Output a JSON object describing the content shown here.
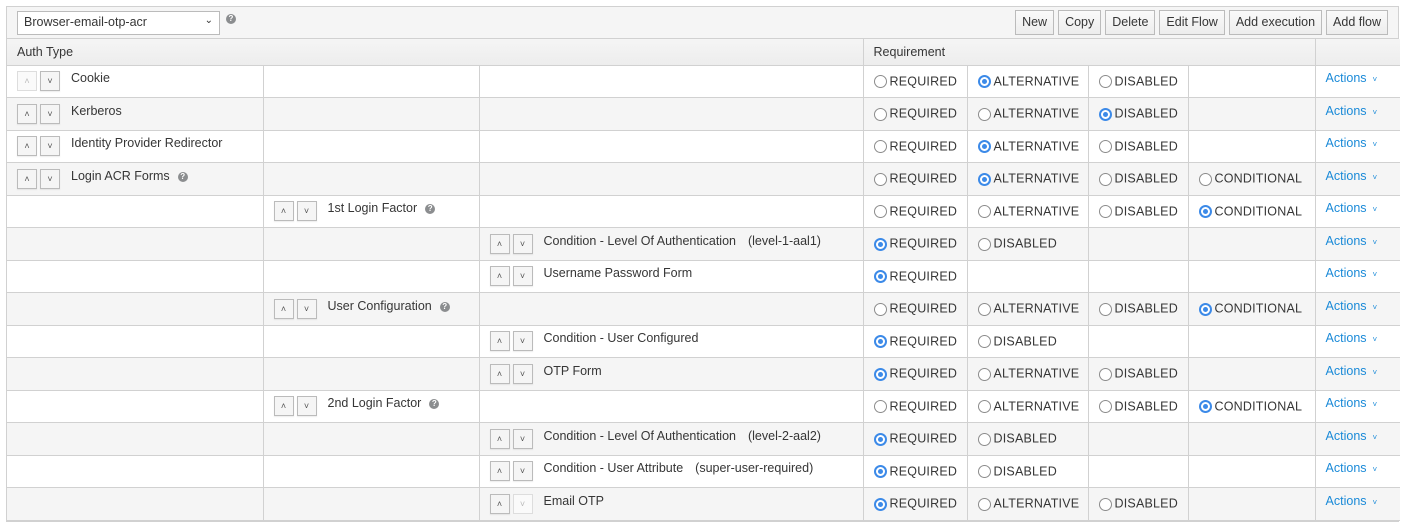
{
  "toolbar": {
    "flow_selected": "Browser-email-otp-acr",
    "buttons": {
      "new": "New",
      "copy": "Copy",
      "delete": "Delete",
      "edit_flow": "Edit Flow",
      "add_execution": "Add execution",
      "add_flow": "Add flow"
    }
  },
  "table": {
    "headers": {
      "auth_type": "Auth Type",
      "requirement": "Requirement"
    },
    "actions_label": "Actions",
    "rows": [
      {
        "level": 0,
        "name": "Cookie",
        "alias": "",
        "help": false,
        "up_disabled": true,
        "down_disabled": false,
        "options": [
          "REQUIRED",
          "ALTERNATIVE",
          "DISABLED"
        ],
        "selected": "ALTERNATIVE"
      },
      {
        "level": 0,
        "name": "Kerberos",
        "alias": "",
        "help": false,
        "up_disabled": false,
        "down_disabled": false,
        "options": [
          "REQUIRED",
          "ALTERNATIVE",
          "DISABLED"
        ],
        "selected": "DISABLED"
      },
      {
        "level": 0,
        "name": "Identity Provider Redirector",
        "alias": "",
        "help": false,
        "up_disabled": false,
        "down_disabled": false,
        "options": [
          "REQUIRED",
          "ALTERNATIVE",
          "DISABLED"
        ],
        "selected": "ALTERNATIVE"
      },
      {
        "level": 0,
        "name": "Login ACR Forms",
        "alias": "",
        "help": true,
        "up_disabled": false,
        "down_disabled": false,
        "options": [
          "REQUIRED",
          "ALTERNATIVE",
          "DISABLED",
          "CONDITIONAL"
        ],
        "selected": "ALTERNATIVE"
      },
      {
        "level": 1,
        "name": "1st Login Factor",
        "alias": "",
        "help": true,
        "up_disabled": false,
        "down_disabled": false,
        "options": [
          "REQUIRED",
          "ALTERNATIVE",
          "DISABLED",
          "CONDITIONAL"
        ],
        "selected": "CONDITIONAL"
      },
      {
        "level": 2,
        "name": "Condition - Level Of Authentication",
        "alias": "(level-1-aal1)",
        "help": false,
        "up_disabled": false,
        "down_disabled": false,
        "options": [
          "REQUIRED",
          "DISABLED"
        ],
        "selected": "REQUIRED"
      },
      {
        "level": 2,
        "name": "Username Password Form",
        "alias": "",
        "help": false,
        "up_disabled": false,
        "down_disabled": false,
        "options": [
          "REQUIRED"
        ],
        "selected": "REQUIRED"
      },
      {
        "level": 1,
        "name": "User Configuration",
        "alias": "",
        "help": true,
        "up_disabled": false,
        "down_disabled": false,
        "options": [
          "REQUIRED",
          "ALTERNATIVE",
          "DISABLED",
          "CONDITIONAL"
        ],
        "selected": "CONDITIONAL"
      },
      {
        "level": 2,
        "name": "Condition - User Configured",
        "alias": "",
        "help": false,
        "up_disabled": false,
        "down_disabled": false,
        "options": [
          "REQUIRED",
          "DISABLED"
        ],
        "selected": "REQUIRED"
      },
      {
        "level": 2,
        "name": "OTP Form",
        "alias": "",
        "help": false,
        "up_disabled": false,
        "down_disabled": false,
        "options": [
          "REQUIRED",
          "ALTERNATIVE",
          "DISABLED"
        ],
        "selected": "REQUIRED"
      },
      {
        "level": 1,
        "name": "2nd Login Factor",
        "alias": "",
        "help": true,
        "up_disabled": false,
        "down_disabled": false,
        "options": [
          "REQUIRED",
          "ALTERNATIVE",
          "DISABLED",
          "CONDITIONAL"
        ],
        "selected": "CONDITIONAL"
      },
      {
        "level": 2,
        "name": "Condition - Level Of Authentication",
        "alias": "(level-2-aal2)",
        "help": false,
        "up_disabled": false,
        "down_disabled": false,
        "options": [
          "REQUIRED",
          "DISABLED"
        ],
        "selected": "REQUIRED"
      },
      {
        "level": 2,
        "name": "Condition - User Attribute",
        "alias": "(super-user-required)",
        "help": false,
        "up_disabled": false,
        "down_disabled": false,
        "options": [
          "REQUIRED",
          "DISABLED"
        ],
        "selected": "REQUIRED"
      },
      {
        "level": 2,
        "name": "Email OTP",
        "alias": "",
        "help": false,
        "up_disabled": false,
        "down_disabled": true,
        "options": [
          "REQUIRED",
          "ALTERNATIVE",
          "DISABLED"
        ],
        "selected": "REQUIRED"
      }
    ]
  },
  "icons": {
    "up": "⌃",
    "down": "⌄",
    "help": "?",
    "chevron": "⌄"
  },
  "colors": {
    "accent": "#3c8ae8",
    "link": "#1a8ad8"
  }
}
